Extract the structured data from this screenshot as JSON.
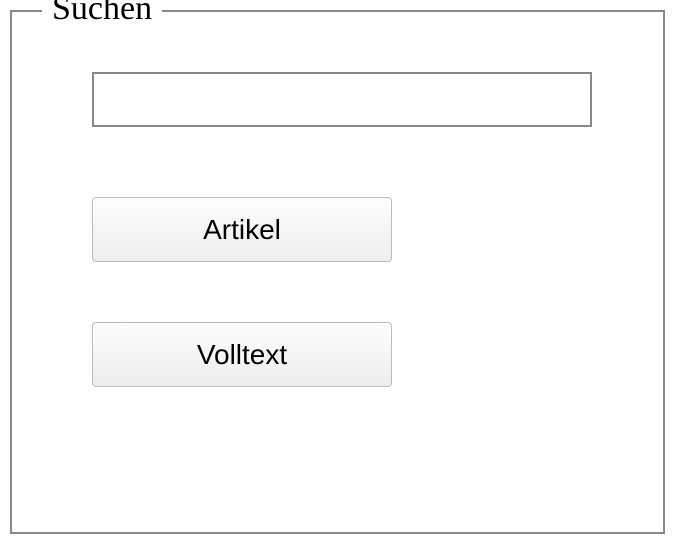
{
  "search": {
    "legend": "Suchen",
    "input_value": "",
    "placeholder": ""
  },
  "buttons": {
    "artikel": "Artikel",
    "volltext": "Volltext"
  }
}
